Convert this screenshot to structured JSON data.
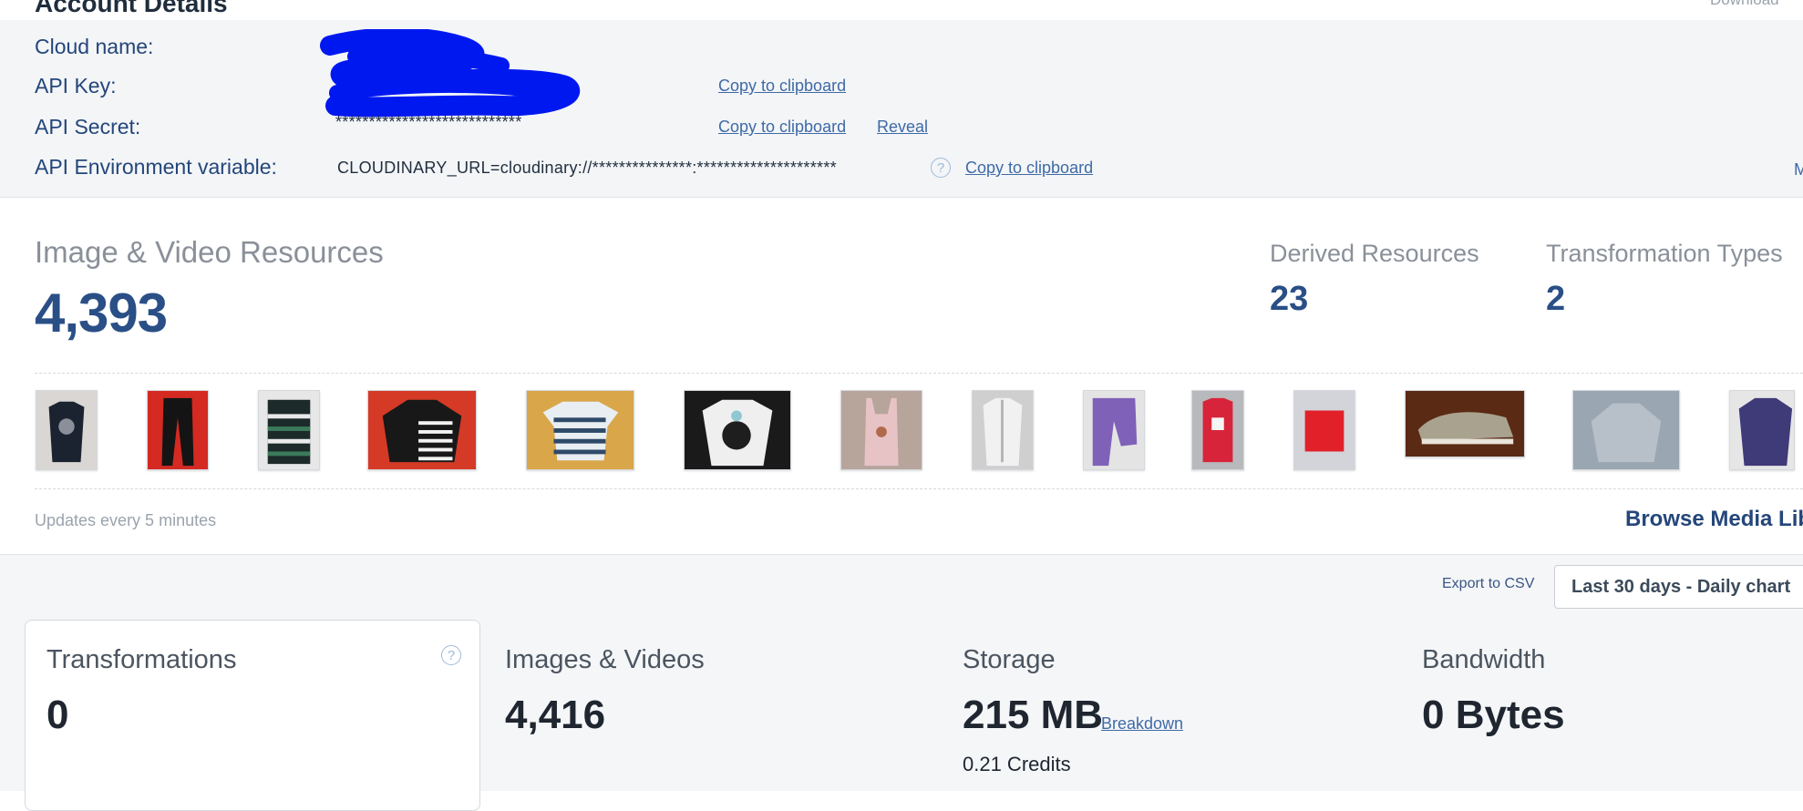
{
  "header": {
    "title": "Account Details",
    "download_label": "Download"
  },
  "account": {
    "cloud_name_label": "Cloud name:",
    "api_key_label": "API Key:",
    "api_secret_label": "API Secret:",
    "api_secret_value": "****************************",
    "env_var_label": "API Environment variable:",
    "env_var_value": "CLOUDINARY_URL=cloudinary://***************:*********************",
    "copy_label": "Copy to clipboard",
    "reveal_label": "Reveal",
    "more_label": "M"
  },
  "resources": {
    "title": "Image & Video Resources",
    "count": "4,393",
    "derived_title": "Derived Resources",
    "derived_count": "23",
    "transform_types_title": "Transformation Types",
    "transform_types_count": "2",
    "updates_note": "Updates every 5 minutes",
    "browse_label": "Browse Media Lib"
  },
  "usage": {
    "export_label": "Export to CSV",
    "range_label": "Last 30 days - Daily chart",
    "transformations_title": "Transformations",
    "transformations_value": "0",
    "images_videos_title": "Images & Videos",
    "images_videos_value": "4,416",
    "storage_title": "Storage",
    "storage_value": "215 MB",
    "breakdown_label": "Breakdown",
    "storage_credits": "0.21 Credits",
    "bandwidth_title": "Bandwidth",
    "bandwidth_value": "0 Bytes"
  },
  "colors": {
    "accent": "#2a4f86",
    "link": "#3f6aa6",
    "redaction": "#0018f0"
  }
}
